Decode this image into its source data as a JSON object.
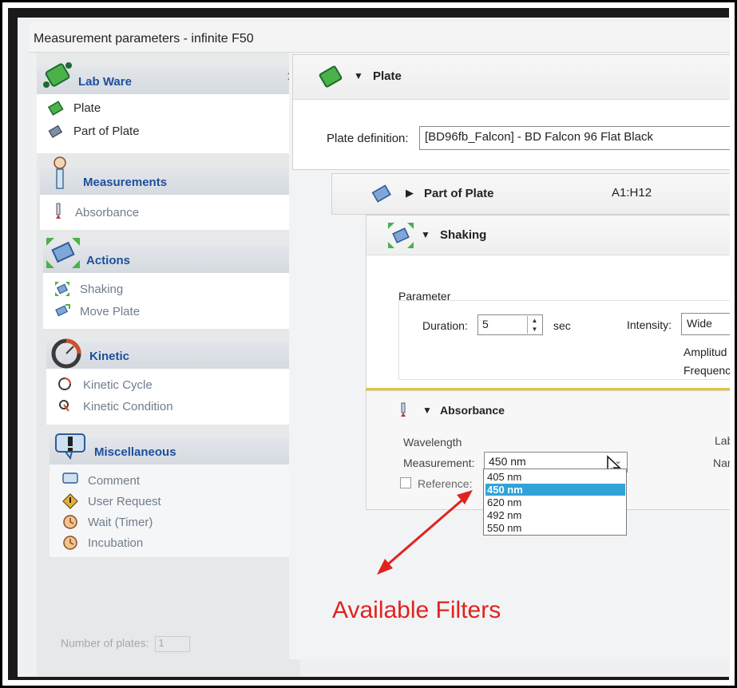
{
  "window": {
    "title": "Measurement parameters - infinite F50"
  },
  "sidebar": {
    "groups": [
      {
        "title": "Lab Ware",
        "items": [
          {
            "label": "Plate"
          },
          {
            "label": "Part of Plate"
          }
        ]
      },
      {
        "title": "Measurements",
        "items": [
          {
            "label": "Absorbance"
          }
        ]
      },
      {
        "title": "Actions",
        "items": [
          {
            "label": "Shaking"
          },
          {
            "label": "Move Plate"
          }
        ]
      },
      {
        "title": "Kinetic",
        "items": [
          {
            "label": "Kinetic Cycle"
          },
          {
            "label": "Kinetic Condition"
          }
        ]
      },
      {
        "title": "Miscellaneous",
        "items": [
          {
            "label": "Comment"
          },
          {
            "label": "User Request"
          },
          {
            "label": "Wait (Timer)"
          },
          {
            "label": "Incubation"
          }
        ]
      }
    ],
    "number_of_plates_label": "Number of plates:",
    "number_of_plates_value": "1"
  },
  "plate": {
    "header": "Plate",
    "definition_label": "Plate definition:",
    "definition_value": "[BD96fb_Falcon] - BD Falcon 96 Flat Black"
  },
  "part_of_plate": {
    "header": "Part of Plate",
    "range": "A1:H12"
  },
  "shaking": {
    "header": "Shaking",
    "parameter_label": "Parameter",
    "duration_label": "Duration:",
    "duration_value": "5",
    "duration_unit": "sec",
    "intensity_label": "Intensity:",
    "intensity_value": "Wide",
    "amplitude_label": "Amplitud",
    "frequency_label": "Frequenc"
  },
  "absorbance": {
    "header": "Absorbance",
    "wavelength_label": "Wavelength",
    "measurement_label": "Measurement:",
    "measurement_value": "450 nm",
    "reference_label": "Reference:",
    "label_label": "Label",
    "name_label": "Name:",
    "options": [
      "405 nm",
      "450 nm",
      "620 nm",
      "492 nm",
      "550 nm"
    ],
    "selected_index": 1
  },
  "annotation": {
    "text": "Available Filters",
    "color": "#e0231e"
  }
}
